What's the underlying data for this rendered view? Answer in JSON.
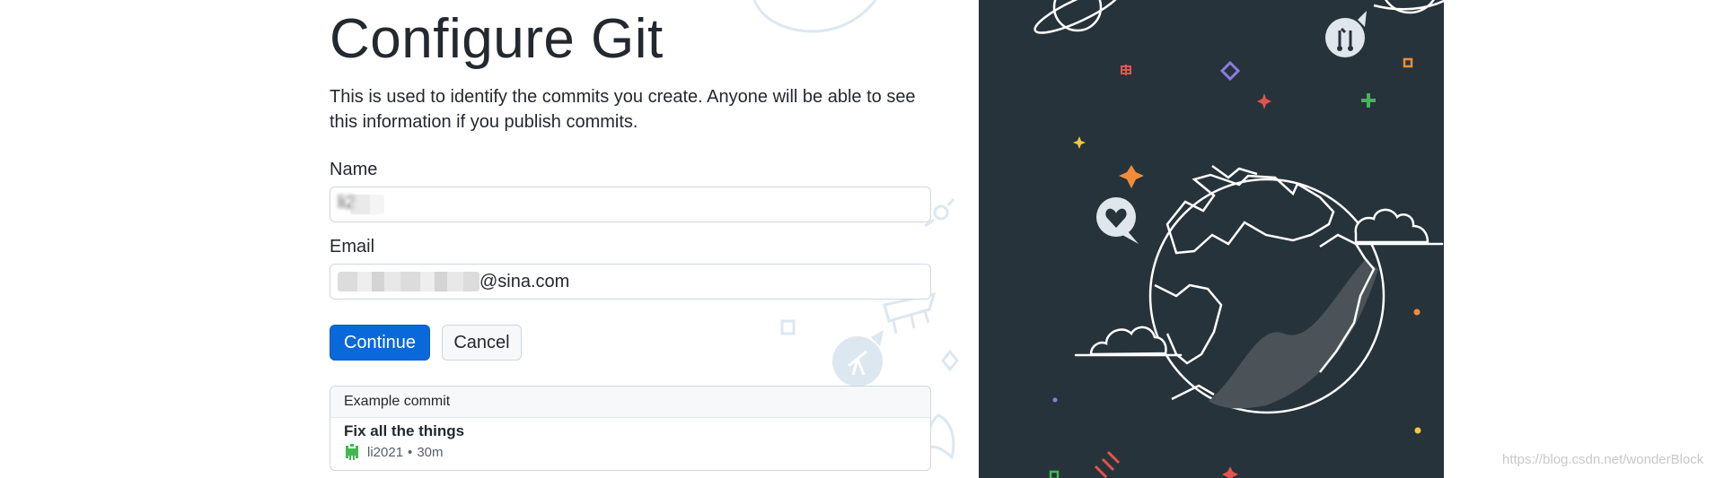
{
  "page": {
    "title": "Configure Git",
    "description": "This is used to identify the commits you create. Anyone will be able to see this information if you publish commits."
  },
  "form": {
    "name_label": "Name",
    "name_value": "li2",
    "email_label": "Email",
    "email_value_visible": "@sina.com"
  },
  "buttons": {
    "continue": "Continue",
    "cancel": "Cancel"
  },
  "example_commit": {
    "header": "Example commit",
    "message": "Fix all the things",
    "author": "li2021",
    "separator": "•",
    "time": "30m"
  },
  "watermark": "https://blog.csdn.net/wonderBlock",
  "colors": {
    "primary": "#0969da",
    "panel_bg": "#27333b"
  },
  "icons": [
    "planet-icon",
    "pull-request-bubble-icon",
    "heart-bubble-icon",
    "globe-illustration",
    "telescope-icon",
    "rocket-icon",
    "sparkle-icon"
  ]
}
